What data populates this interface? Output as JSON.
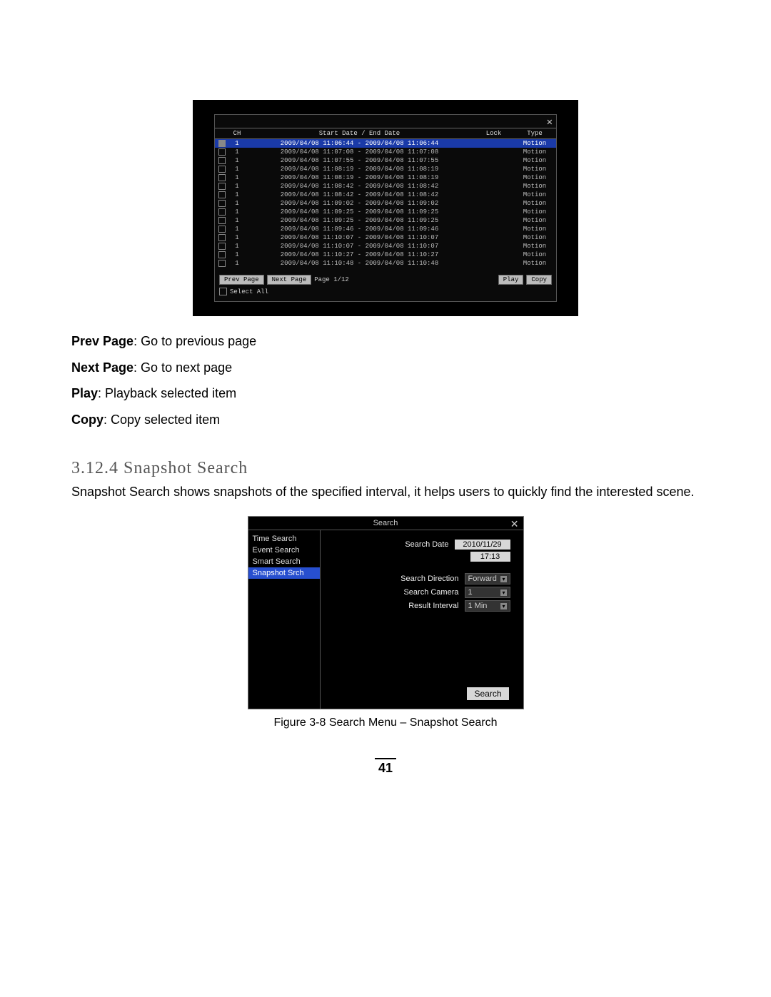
{
  "screenshot1": {
    "headers": {
      "ch": "CH",
      "dates": "Start Date / End Date",
      "lock": "Lock",
      "type": "Type"
    },
    "rows": [
      {
        "sel": true,
        "ch": "1",
        "start": "2009/04/08 11:06:44",
        "end": "2009/04/08 11:06:44",
        "type": "Motion"
      },
      {
        "sel": false,
        "ch": "1",
        "start": "2009/04/08 11:07:08",
        "end": "2009/04/08 11:07:08",
        "type": "Motion"
      },
      {
        "sel": false,
        "ch": "1",
        "start": "2009/04/08 11:07:55",
        "end": "2009/04/08 11:07:55",
        "type": "Motion"
      },
      {
        "sel": false,
        "ch": "1",
        "start": "2009/04/08 11:08:19",
        "end": "2009/04/08 11:08:19",
        "type": "Motion"
      },
      {
        "sel": false,
        "ch": "1",
        "start": "2009/04/08 11:08:19",
        "end": "2009/04/08 11:08:19",
        "type": "Motion"
      },
      {
        "sel": false,
        "ch": "1",
        "start": "2009/04/08 11:08:42",
        "end": "2009/04/08 11:08:42",
        "type": "Motion"
      },
      {
        "sel": false,
        "ch": "1",
        "start": "2009/04/08 11:08:42",
        "end": "2009/04/08 11:08:42",
        "type": "Motion"
      },
      {
        "sel": false,
        "ch": "1",
        "start": "2009/04/08 11:09:02",
        "end": "2009/04/08 11:09:02",
        "type": "Motion"
      },
      {
        "sel": false,
        "ch": "1",
        "start": "2009/04/08 11:09:25",
        "end": "2009/04/08 11:09:25",
        "type": "Motion"
      },
      {
        "sel": false,
        "ch": "1",
        "start": "2009/04/08 11:09:25",
        "end": "2009/04/08 11:09:25",
        "type": "Motion"
      },
      {
        "sel": false,
        "ch": "1",
        "start": "2009/04/08 11:09:46",
        "end": "2009/04/08 11:09:46",
        "type": "Motion"
      },
      {
        "sel": false,
        "ch": "1",
        "start": "2009/04/08 11:10:07",
        "end": "2009/04/08 11:10:07",
        "type": "Motion"
      },
      {
        "sel": false,
        "ch": "1",
        "start": "2009/04/08 11:10:07",
        "end": "2009/04/08 11:10:07",
        "type": "Motion"
      },
      {
        "sel": false,
        "ch": "1",
        "start": "2009/04/08 11:10:27",
        "end": "2009/04/08 11:10:27",
        "type": "Motion"
      },
      {
        "sel": false,
        "ch": "1",
        "start": "2009/04/08 11:10:48",
        "end": "2009/04/08 11:10:48",
        "type": "Motion"
      }
    ],
    "date_sep": " - ",
    "footer": {
      "prev": "Prev Page",
      "next": "Next Page",
      "page": "Page 1/12",
      "play": "Play",
      "copy": "Copy",
      "select_all": "Select All"
    }
  },
  "definitions": {
    "prev_b": "Prev Page",
    "prev_t": ": Go to previous page",
    "next_b": "Next Page",
    "next_t": ": Go to next page",
    "play_b": "Play",
    "play_t": ": Playback selected item",
    "copy_b": "Copy",
    "copy_t": ": Copy selected item"
  },
  "section": {
    "heading": "3.12.4 Snapshot Search",
    "paragraph": "Snapshot Search shows snapshots of the specified interval, it helps users to quickly find the interested scene."
  },
  "screenshot2": {
    "title": "Search",
    "side": {
      "items": [
        "Time Search",
        "Event Search",
        "Smart Search",
        "Snapshot Srch"
      ],
      "sel_index": 3
    },
    "fields": {
      "search_date_label": "Search Date",
      "search_date_value": "2010/11/29",
      "search_time_value": "17:13",
      "direction_label": "Search Direction",
      "direction_value": "Forward",
      "camera_label": "Search Camera",
      "camera_value": "1",
      "interval_label": "Result Interval",
      "interval_value": "1 Min",
      "search_button": "Search"
    }
  },
  "caption2": "Figure 3-8 Search Menu – Snapshot Search",
  "page_number": "41"
}
